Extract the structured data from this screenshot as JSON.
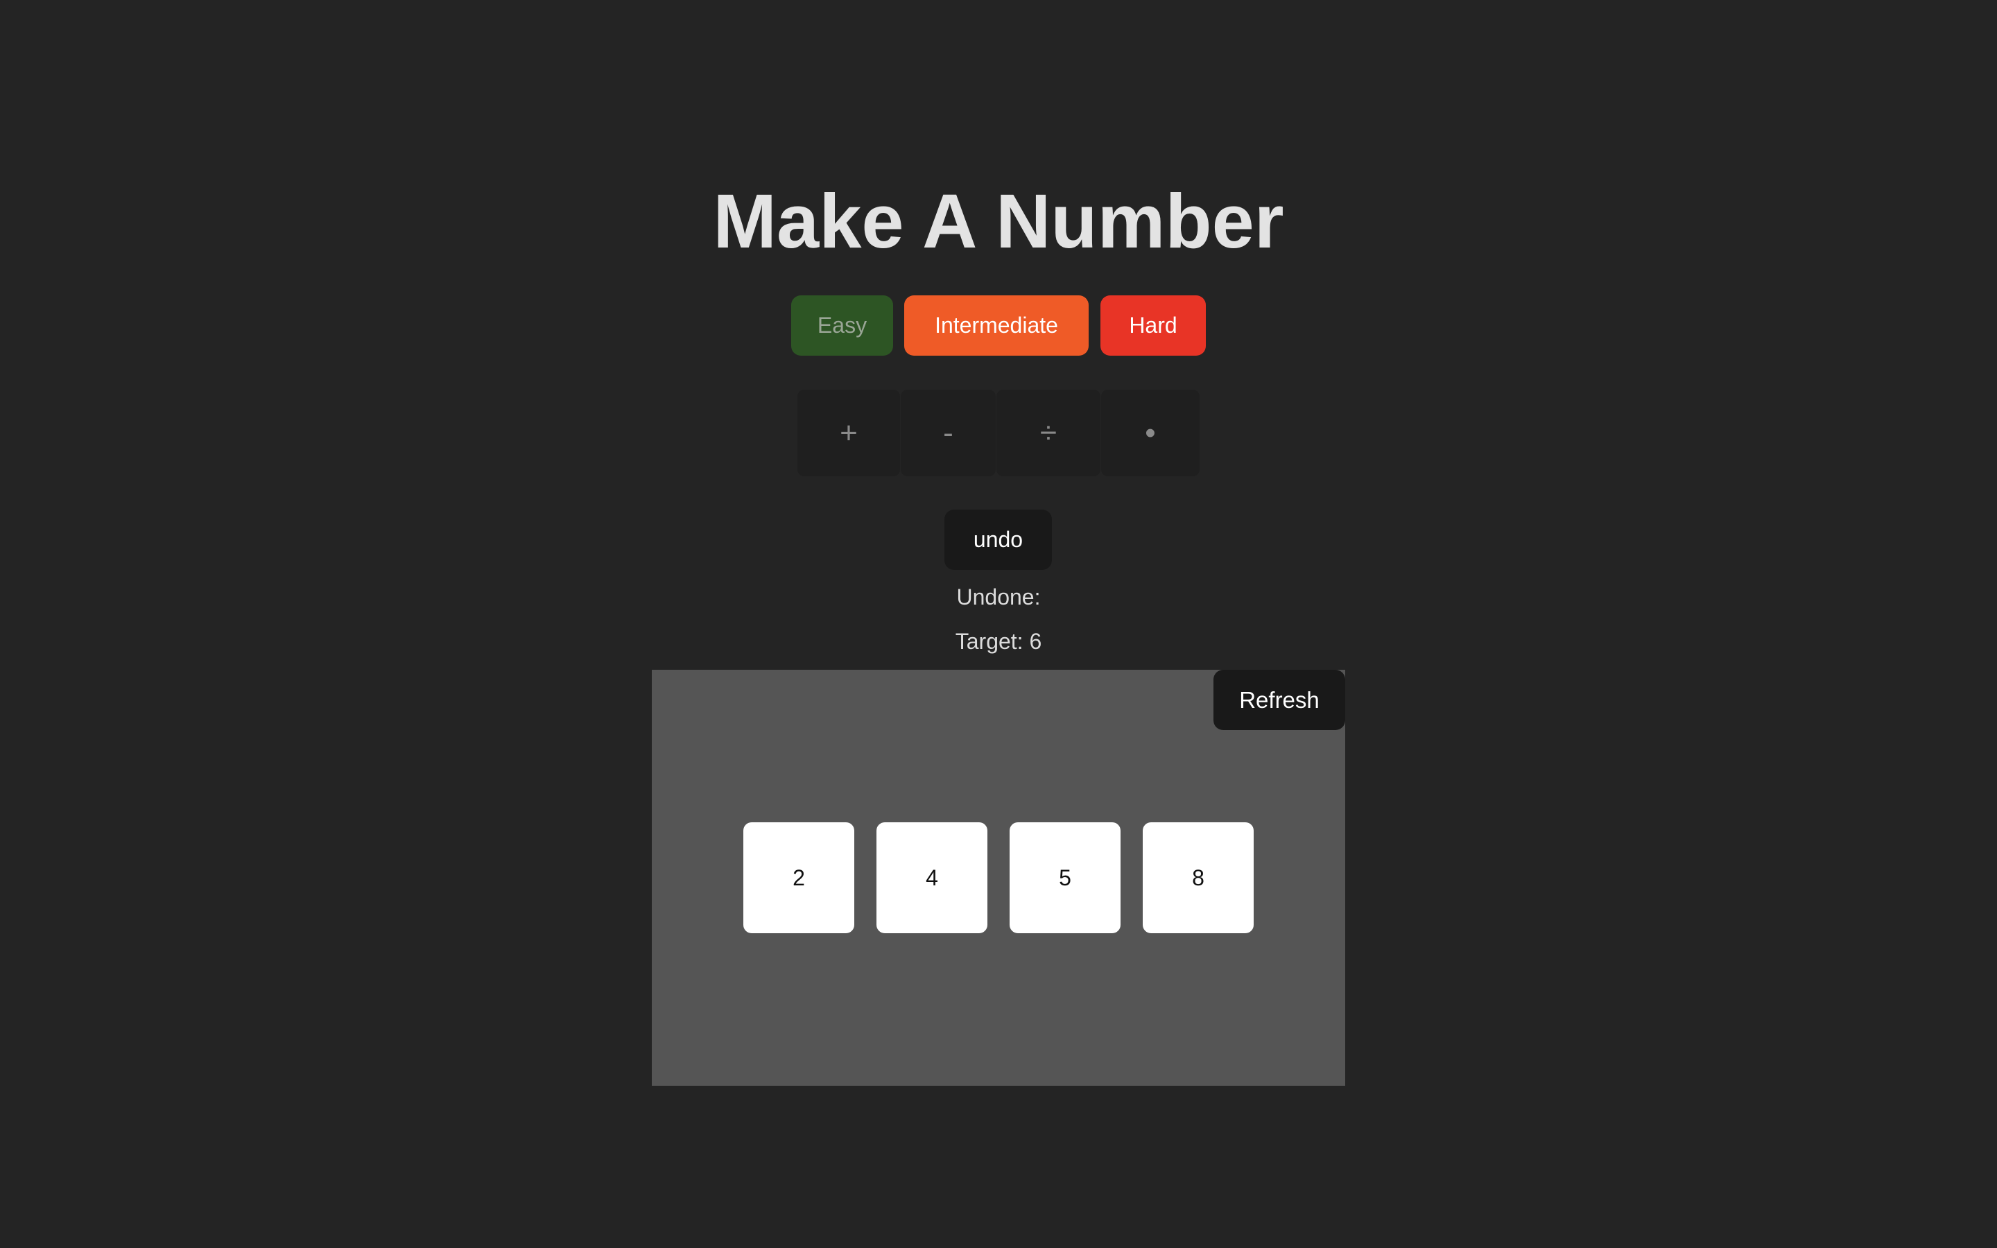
{
  "title": "Make A Number",
  "difficulty": {
    "easy": "Easy",
    "intermediate": "Intermediate",
    "hard": "Hard"
  },
  "operators": {
    "plus": "+",
    "minus": "-",
    "divide": "÷",
    "times": "•"
  },
  "undo_label": "undo",
  "undone_label": "Undone:",
  "target_label": "Target: 6",
  "refresh_label": "Refresh",
  "cards": [
    "2",
    "4",
    "5",
    "8"
  ],
  "colors": {
    "background": "#242424",
    "easy": "#2d5524",
    "intermediate": "#ef5b27",
    "hard": "#e83426",
    "board": "#555555",
    "card": "#ffffff"
  }
}
